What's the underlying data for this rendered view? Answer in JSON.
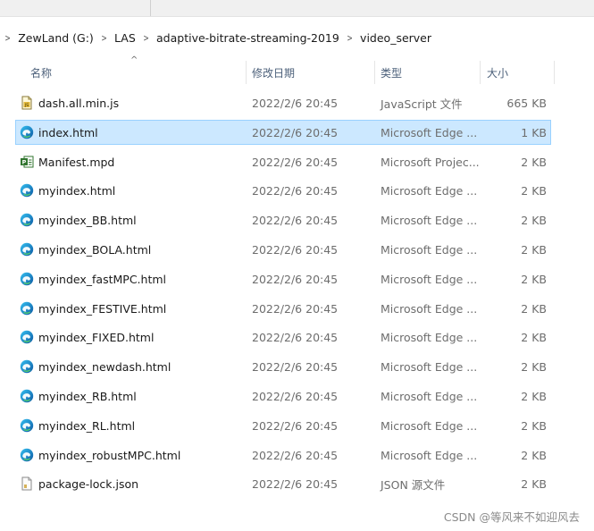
{
  "breadcrumb": [
    "ZewLand (G:)",
    "LAS",
    "adaptive-bitrate-streaming-2019",
    "video_server"
  ],
  "columns": {
    "name": "名称",
    "date": "修改日期",
    "type": "类型",
    "size": "大小"
  },
  "files": [
    {
      "name": "dash.all.min.js",
      "date": "2022/2/6 20:45",
      "type": "JavaScript 文件",
      "size": "665 KB",
      "icon": "javascript-file-icon",
      "selected": false
    },
    {
      "name": "index.html",
      "date": "2022/2/6 20:45",
      "type": "Microsoft Edge ...",
      "size": "1 KB",
      "icon": "edge-icon",
      "selected": true
    },
    {
      "name": "Manifest.mpd",
      "date": "2022/2/6 20:45",
      "type": "Microsoft Projec...",
      "size": "2 KB",
      "icon": "project-file-icon",
      "selected": false
    },
    {
      "name": "myindex.html",
      "date": "2022/2/6 20:45",
      "type": "Microsoft Edge ...",
      "size": "2 KB",
      "icon": "edge-icon",
      "selected": false
    },
    {
      "name": "myindex_BB.html",
      "date": "2022/2/6 20:45",
      "type": "Microsoft Edge ...",
      "size": "2 KB",
      "icon": "edge-icon",
      "selected": false
    },
    {
      "name": "myindex_BOLA.html",
      "date": "2022/2/6 20:45",
      "type": "Microsoft Edge ...",
      "size": "2 KB",
      "icon": "edge-icon",
      "selected": false
    },
    {
      "name": "myindex_fastMPC.html",
      "date": "2022/2/6 20:45",
      "type": "Microsoft Edge ...",
      "size": "2 KB",
      "icon": "edge-icon",
      "selected": false
    },
    {
      "name": "myindex_FESTIVE.html",
      "date": "2022/2/6 20:45",
      "type": "Microsoft Edge ...",
      "size": "2 KB",
      "icon": "edge-icon",
      "selected": false
    },
    {
      "name": "myindex_FIXED.html",
      "date": "2022/2/6 20:45",
      "type": "Microsoft Edge ...",
      "size": "2 KB",
      "icon": "edge-icon",
      "selected": false
    },
    {
      "name": "myindex_newdash.html",
      "date": "2022/2/6 20:45",
      "type": "Microsoft Edge ...",
      "size": "2 KB",
      "icon": "edge-icon",
      "selected": false
    },
    {
      "name": "myindex_RB.html",
      "date": "2022/2/6 20:45",
      "type": "Microsoft Edge ...",
      "size": "2 KB",
      "icon": "edge-icon",
      "selected": false
    },
    {
      "name": "myindex_RL.html",
      "date": "2022/2/6 20:45",
      "type": "Microsoft Edge ...",
      "size": "2 KB",
      "icon": "edge-icon",
      "selected": false
    },
    {
      "name": "myindex_robustMPC.html",
      "date": "2022/2/6 20:45",
      "type": "Microsoft Edge ...",
      "size": "2 KB",
      "icon": "edge-icon",
      "selected": false
    },
    {
      "name": "package-lock.json",
      "date": "2022/2/6 20:45",
      "type": "JSON 源文件",
      "size": "2 KB",
      "icon": "json-file-icon",
      "selected": false
    }
  ],
  "watermark": "CSDN @等风来不如迎风去",
  "colors": {
    "selected_bg": "#cce8ff",
    "selected_border": "#99d1ff",
    "header_text": "#4c607a",
    "meta_text": "#6d6d6d"
  }
}
